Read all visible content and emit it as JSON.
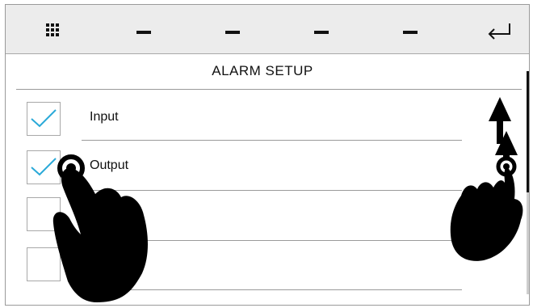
{
  "toolbar": {
    "left_icon": "grid-menu-icon",
    "slots": [
      "dash-icon",
      "dash-icon",
      "dash-icon",
      "dash-icon"
    ],
    "right_icon": "enter-return-icon"
  },
  "screen": {
    "title": "ALARM SETUP"
  },
  "rows": [
    {
      "label": "Input",
      "checked": true
    },
    {
      "label": "Output",
      "checked": true
    },
    {
      "label": "",
      "checked": false
    },
    {
      "label": "",
      "checked": false
    }
  ],
  "colors": {
    "check": "#2aa9d8",
    "toolbar_bg": "#ececec",
    "rule": "#9a9a9a"
  },
  "gestures": [
    "tap-gesture-icon",
    "swipe-up-down-gesture-icon"
  ]
}
